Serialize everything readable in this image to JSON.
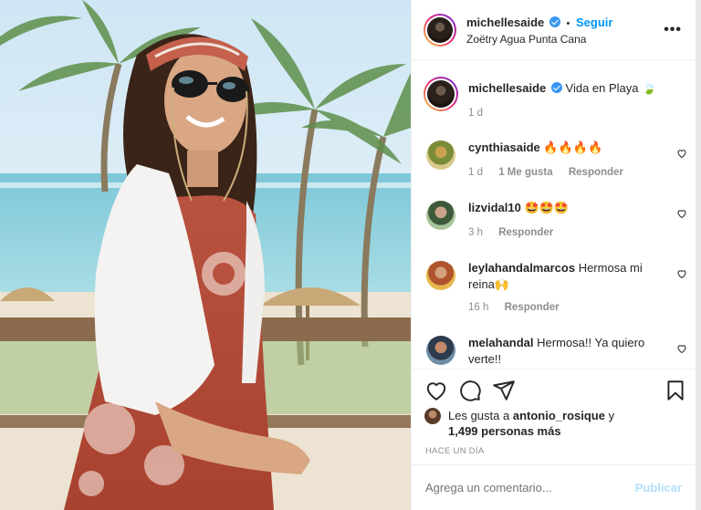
{
  "post": {
    "image_alt": "Woman in sunglasses and headband posing on a beach terrace with palm trees"
  },
  "header": {
    "username": "michellesaide",
    "separator": "•",
    "follow_label": "Seguir",
    "location": "Zoëtry Agua Punta Cana",
    "more_icon": "more-dots-icon"
  },
  "caption": {
    "username": "michellesaide",
    "text": "Vida en Playa 🍃",
    "time": "1 d"
  },
  "comments": [
    {
      "username": "cynthiasaide",
      "text": "🔥🔥🔥🔥",
      "time": "1 d",
      "likes": "1 Me gusta",
      "reply": "Responder"
    },
    {
      "username": "lizvidal10",
      "text": "🤩🤩🤩",
      "time": "3 h",
      "reply": "Responder"
    },
    {
      "username": "leylahandalmarcos",
      "text": "Hermosa mi reina🙌",
      "time": "16 h",
      "reply": "Responder"
    },
    {
      "username": "melahandal",
      "text": "Hermosa!! Ya quiero verte!!"
    }
  ],
  "actions": {
    "like_icon": "heart-icon",
    "comment_icon": "comment-icon",
    "share_icon": "paper-plane-icon",
    "save_icon": "bookmark-icon"
  },
  "likes": {
    "prefix": "Les gusta a",
    "user": "antonio_rosique",
    "joiner": "y",
    "others": "1,499 personas más"
  },
  "timestamp": "HACE UN DÍA",
  "composer": {
    "placeholder": "Agrega un comentario...",
    "post_label": "Publicar"
  },
  "colors": {
    "link_blue": "#0095f6",
    "verified_blue": "#3897f0",
    "muted": "#8e8e8e",
    "publish_disabled": "#b2dffc"
  }
}
